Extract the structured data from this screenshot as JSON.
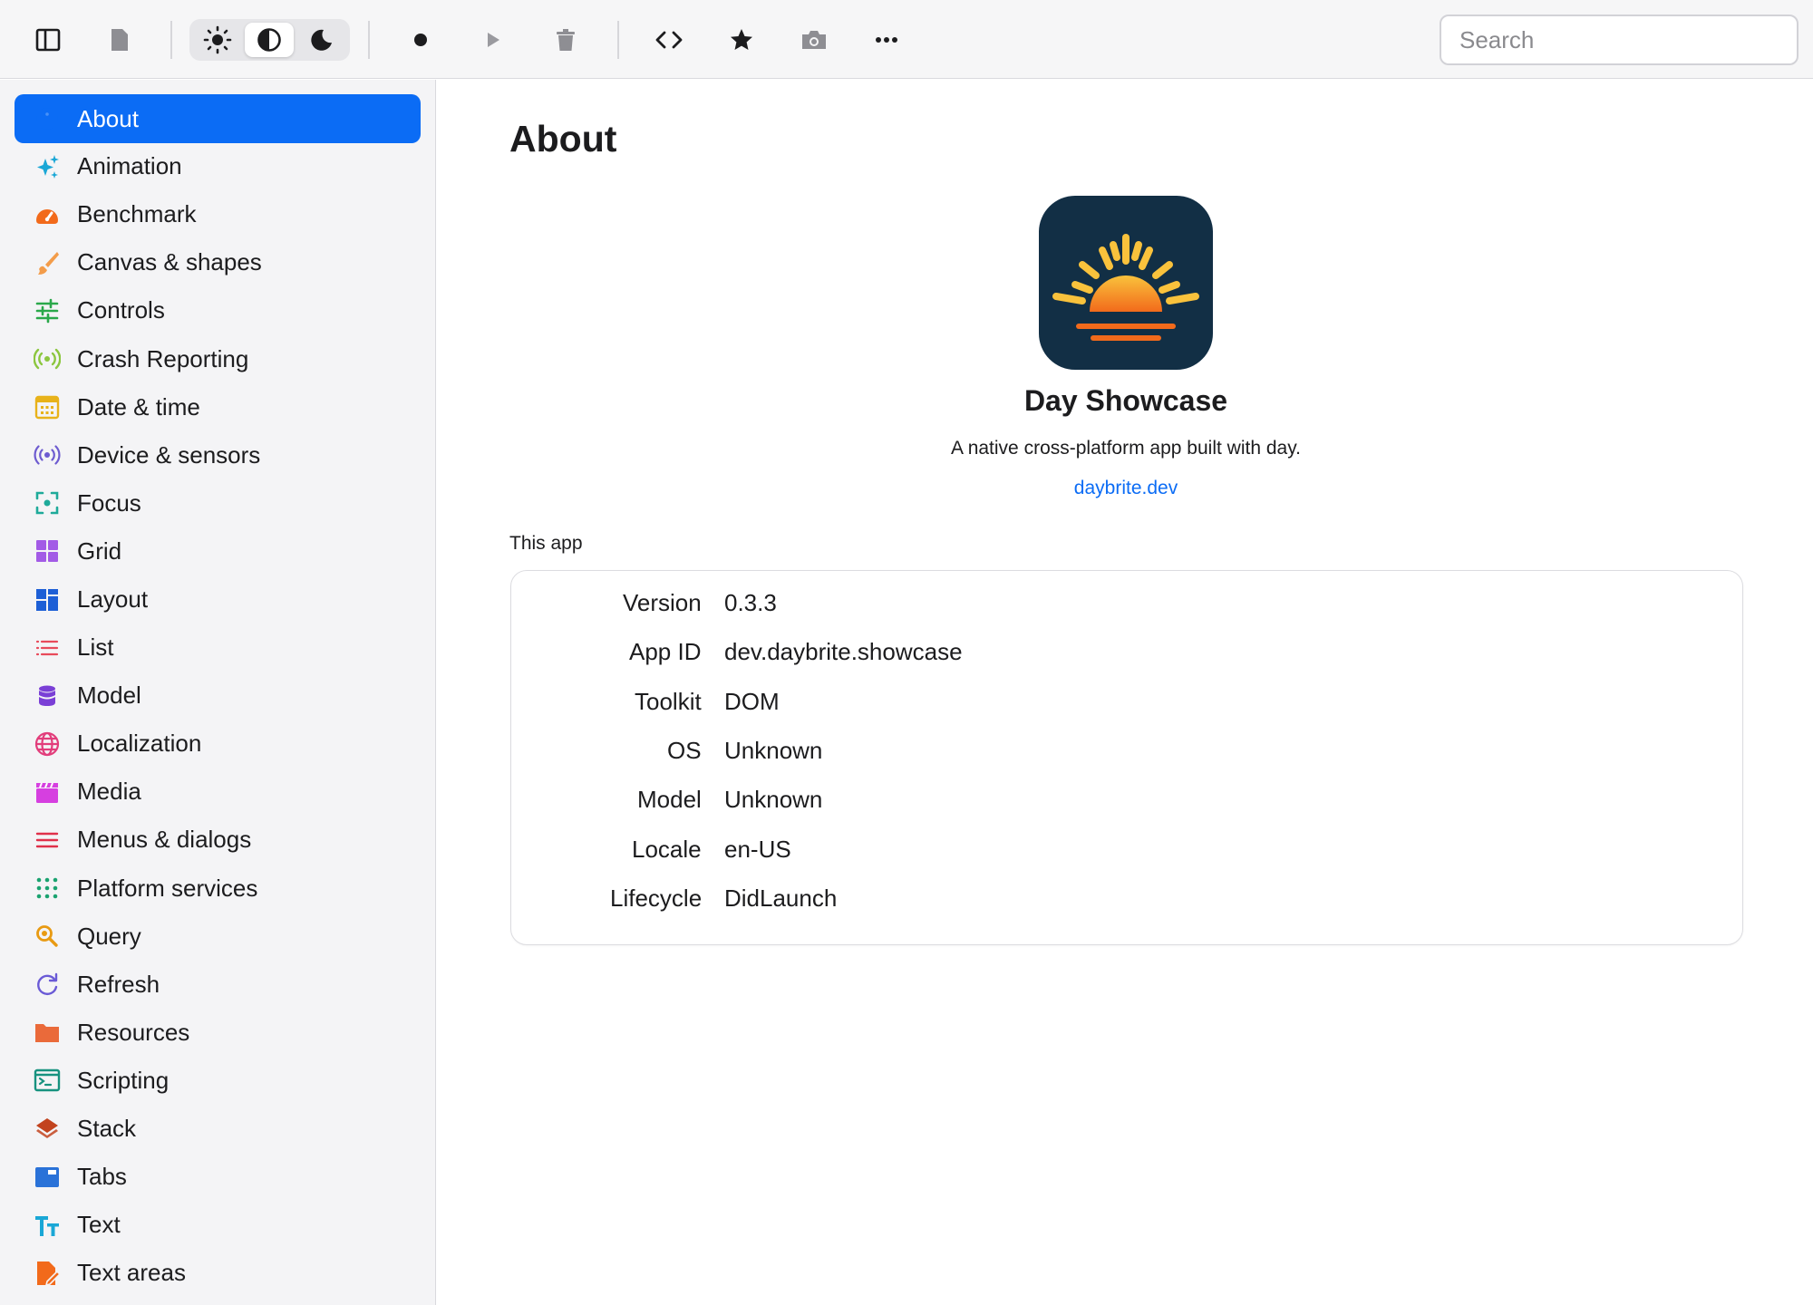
{
  "toolbar": {
    "search_placeholder": "Search",
    "icons": [
      "sidebar-toggle-icon",
      "document-icon",
      "sun-icon",
      "contrast-icon",
      "moon-icon",
      "record-icon",
      "play-icon",
      "trash-icon",
      "code-icon",
      "star-icon",
      "camera-icon",
      "more-icon"
    ],
    "theme_selected": "contrast"
  },
  "sidebar": {
    "items": [
      {
        "label": "About",
        "icon": "info-icon",
        "color": "#0b6cf5",
        "active": true
      },
      {
        "label": "Animation",
        "icon": "sparkles-icon",
        "color": "#1aa7d6"
      },
      {
        "label": "Benchmark",
        "icon": "gauge-icon",
        "color": "#f26a1b"
      },
      {
        "label": "Canvas & shapes",
        "icon": "paintbrush-icon",
        "color": "#f39c4a"
      },
      {
        "label": "Controls",
        "icon": "sliders-icon",
        "color": "#2aa84a"
      },
      {
        "label": "Crash Reporting",
        "icon": "broadcast-icon",
        "color": "#8cc63f"
      },
      {
        "label": "Date & time",
        "icon": "calendar-icon",
        "color": "#e8b21a"
      },
      {
        "label": "Device & sensors",
        "icon": "sensor-icon",
        "color": "#6d5bd0"
      },
      {
        "label": "Focus",
        "icon": "focus-icon",
        "color": "#1eaa9a"
      },
      {
        "label": "Grid",
        "icon": "grid-icon",
        "color": "#a35be6"
      },
      {
        "label": "Layout",
        "icon": "layout-icon",
        "color": "#1d5fd6"
      },
      {
        "label": "List",
        "icon": "list-icon",
        "color": "#e84a5a"
      },
      {
        "label": "Model",
        "icon": "database-icon",
        "color": "#7a3fd6"
      },
      {
        "label": "Localization",
        "icon": "globe-icon",
        "color": "#e23d7b"
      },
      {
        "label": "Media",
        "icon": "clapperboard-icon",
        "color": "#d63fe0"
      },
      {
        "label": "Menus & dialogs",
        "icon": "menu-icon",
        "color": "#e0304a"
      },
      {
        "label": "Platform services",
        "icon": "dots-grid-icon",
        "color": "#1aa370"
      },
      {
        "label": "Query",
        "icon": "magnifier-icon",
        "color": "#e89a12"
      },
      {
        "label": "Refresh",
        "icon": "refresh-icon",
        "color": "#6a5ad6"
      },
      {
        "label": "Resources",
        "icon": "folder-icon",
        "color": "#ea6a3a"
      },
      {
        "label": "Scripting",
        "icon": "terminal-icon",
        "color": "#17927f"
      },
      {
        "label": "Stack",
        "icon": "layers-icon",
        "color": "#c2431e"
      },
      {
        "label": "Tabs",
        "icon": "tabs-icon",
        "color": "#2a72d8"
      },
      {
        "label": "Text",
        "icon": "text-icon",
        "color": "#1aa7d6"
      },
      {
        "label": "Text areas",
        "icon": "document-edit-icon",
        "color": "#f26a1b"
      }
    ]
  },
  "main": {
    "title": "About",
    "app_name": "Day Showcase",
    "app_description": "A native cross-platform app built with day.",
    "app_link": "daybrite.dev",
    "section_label": "This app",
    "info_rows": [
      {
        "key": "Version",
        "value": "0.3.3"
      },
      {
        "key": "App ID",
        "value": "dev.daybrite.showcase"
      },
      {
        "key": "Toolkit",
        "value": "DOM"
      },
      {
        "key": "OS",
        "value": " Unknown"
      },
      {
        "key": "Model",
        "value": "Unknown"
      },
      {
        "key": "Locale",
        "value": "en-US"
      },
      {
        "key": "Lifecycle",
        "value": "DidLaunch"
      }
    ]
  },
  "colors": {
    "accent": "#0b6cf5",
    "app_icon_bg": "#122f45",
    "sun_top": "#f9c23c",
    "sun_bottom": "#f26a1b"
  }
}
